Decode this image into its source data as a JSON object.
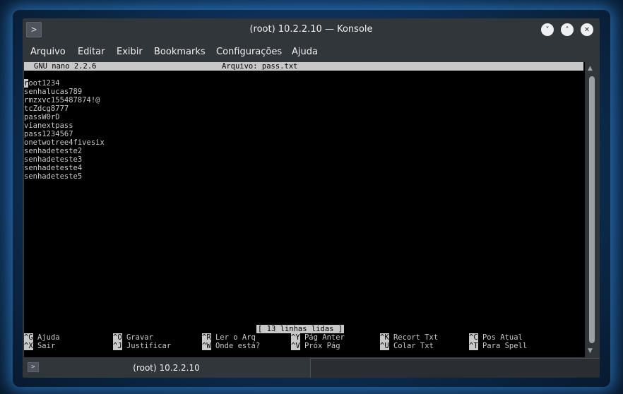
{
  "window": {
    "title": "(root) 10.2.2.10 — Konsole",
    "app_icon": "terminal-icon",
    "buttons": {
      "minimize": "˅",
      "maximize": "˄",
      "close": "✕"
    }
  },
  "menubar": {
    "items": [
      "Arquivo",
      "Editar",
      "Exibir",
      "Bookmarks",
      "Configurações",
      "Ajuda"
    ]
  },
  "nano": {
    "version": "GNU nano 2.2.6",
    "file": "Arquivo: pass.txt",
    "lines": [
      "root1234",
      "senhalucas789",
      "rmzxvc155487874!@",
      "tcZdcg8777",
      "passW0rD",
      "vianextpass",
      "pass1234567",
      "onetwotree4fivesix",
      "senhadeteste2",
      "senhadeteste3",
      "senhadeteste4",
      "senhadeteste5"
    ],
    "status": "[ 13 linhas lidas ]",
    "shortcuts": [
      {
        "key": "^G",
        "label": "Ajuda"
      },
      {
        "key": "^O",
        "label": "Gravar"
      },
      {
        "key": "^R",
        "label": "Ler o Arq"
      },
      {
        "key": "^Y",
        "label": "Pág Anter"
      },
      {
        "key": "^K",
        "label": "Recort Txt"
      },
      {
        "key": "^C",
        "label": "Pos Atual"
      },
      {
        "key": "^X",
        "label": "Sair"
      },
      {
        "key": "^J",
        "label": "Justificar"
      },
      {
        "key": "^W",
        "label": "Onde está?"
      },
      {
        "key": "^V",
        "label": "Próx Pág"
      },
      {
        "key": "^U",
        "label": "Colar Txt"
      },
      {
        "key": "^T",
        "label": "Para Spell"
      }
    ]
  },
  "tabbar": {
    "tab_label": "(root) 10.2.2.10"
  },
  "colors": {
    "window_bg": "#31363b",
    "terminal_bg": "#000000",
    "terminal_fg": "#c8c8c8",
    "desktop_glow": "#3ca0ff"
  }
}
